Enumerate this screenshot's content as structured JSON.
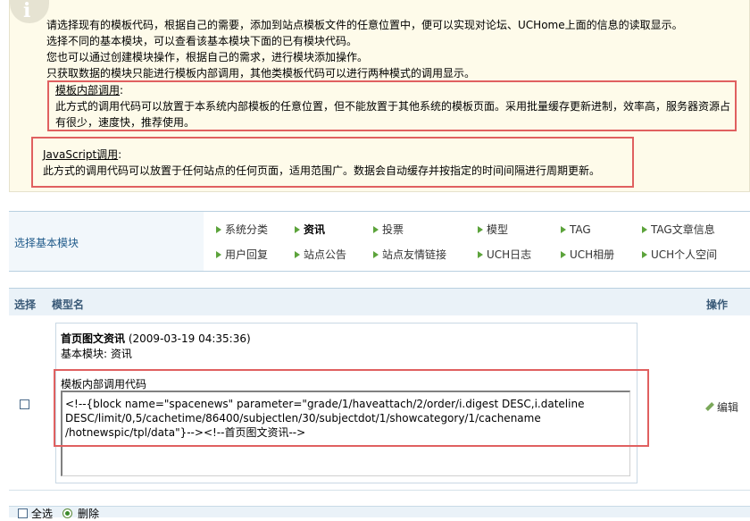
{
  "info": {
    "icon": "info-icon",
    "icon_glyph": "i",
    "lines": [
      "请选择现有的模板代码，根据自己的需要，添加到站点模板文件的任意位置中，便可以实现对论坛、UCHome上面的信息的读取显示。",
      "选择不同的基本模块，可以查看该基本模块下面的已有模块代码。",
      "您也可以通过创建模块操作，根据自己的需求，进行模块添加操作。",
      "只获取数据的模块只能进行模板内部调用，其他类模板代码可以进行两种模式的调用显示。"
    ],
    "internal_title": "模板内部调用",
    "internal_colon": ":",
    "internal_desc_1": "此方式的调用代码可以放置于本系统内部模板的任意位置，但不能放置于其他系统的模板页面。采用批量缓存更新进制，效率高，服务器资源占",
    "internal_desc_2": "有很少，速度快，推荐使用。",
    "js_title": "JavaScript调用",
    "js_colon": ":",
    "js_desc": "此方式的调用代码可以放置于任何站点的任何页面，适用范围广。数据会自动缓存并按指定的时间间隔进行周期更新。"
  },
  "modules": {
    "label": "选择基本模块",
    "selected": "资讯",
    "row1": [
      "系统分类",
      "资讯",
      "投票",
      "模型",
      "TAG",
      "TAG文章信息"
    ],
    "row2": [
      "用户回复",
      "站点公告",
      "站点友情链接",
      "UCH日志",
      "UCH相册",
      "UCH个人空间"
    ]
  },
  "table": {
    "col_select": "选择",
    "col_name": "模型名",
    "col_action": "操作",
    "item": {
      "title": "首页图文资讯",
      "date": "(2009-03-19 04:35:36)",
      "base_module": "基本模块: 资讯",
      "code_label": "模板内部调用代码",
      "code_lines": [
        "<!--{block name=\"spacenews\" parameter=\"grade/1/haveattach/2/order/i.digest DESC,i.dateline",
        "DESC/limit/0,5/cachetime/86400/subjectlen/30/subjectdot/1/showcategory/1/cachename",
        "/hotnewspic/tpl/data\"}--><!--首页图文资讯-->"
      ],
      "edit_label": "编辑"
    }
  },
  "footer": {
    "select_all": "全选",
    "delete": "删除"
  }
}
